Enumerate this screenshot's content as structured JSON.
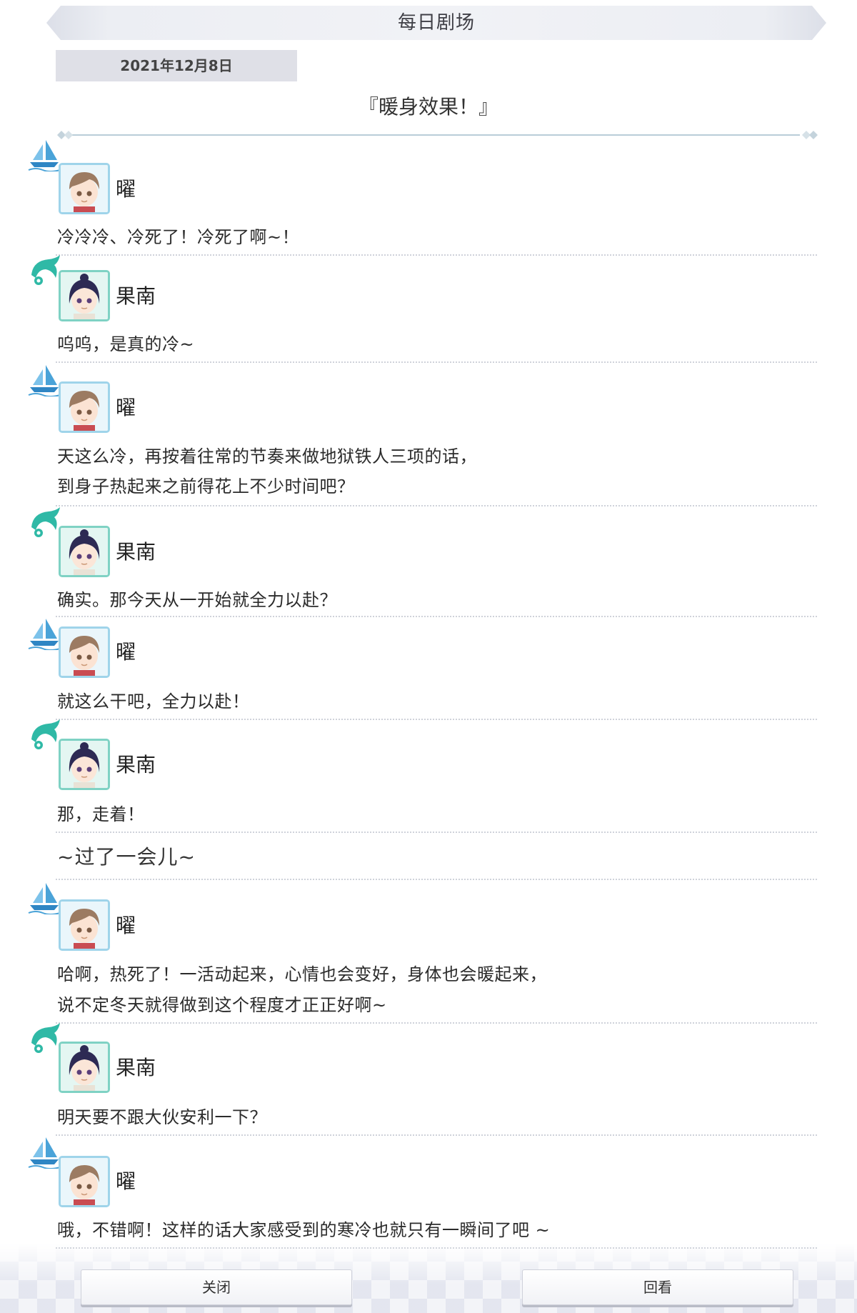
{
  "header": {
    "title": "每日剧场"
  },
  "date": "2021年12月8日",
  "story_title": "『暖身效果！』",
  "speakers": {
    "you": "曜",
    "kanan": "果南"
  },
  "dialogue": [
    {
      "speaker": "曜",
      "character": "you",
      "lines": [
        "冷冷冷、冷死了！冷死了啊~！"
      ]
    },
    {
      "speaker": "果南",
      "character": "kanan",
      "lines": [
        "呜呜，是真的冷~"
      ]
    },
    {
      "speaker": "曜",
      "character": "you",
      "lines": [
        "天这么冷，再按着往常的节奏来做地狱铁人三项的话，",
        "到身子热起来之前得花上不少时间吧？"
      ]
    },
    {
      "speaker": "果南",
      "character": "kanan",
      "lines": [
        "确实。那今天从一开始就全力以赴？"
      ]
    },
    {
      "speaker": "曜",
      "character": "you",
      "lines": [
        "就这么干吧，全力以赴！"
      ]
    },
    {
      "speaker": "果南",
      "character": "kanan",
      "lines": [
        "那，走着！"
      ]
    },
    {
      "speaker": "曜",
      "character": "you",
      "lines": [
        "哈啊，热死了！一活动起来，心情也会变好，身体也会暖起来，",
        "说不定冬天就得做到这个程度才正正好啊~"
      ]
    },
    {
      "speaker": "果南",
      "character": "kanan",
      "lines": [
        "明天要不跟大伙安利一下？"
      ]
    },
    {
      "speaker": "曜",
      "character": "you",
      "lines": [
        "哦，不错啊！这样的话大家感受到的寒冷也就只有一瞬间了吧 ~"
      ]
    }
  ],
  "narration": "~过了一会儿~",
  "buttons": {
    "close": "关闭",
    "review": "回看"
  },
  "icons": {
    "you": "sailboat-icon",
    "kanan": "dolphin-icon"
  },
  "colors": {
    "you_frame": "#9fd4ea",
    "kanan_frame": "#7fd2c4",
    "icon_blue": "#4aa3d8",
    "icon_teal": "#2fb9a6"
  }
}
